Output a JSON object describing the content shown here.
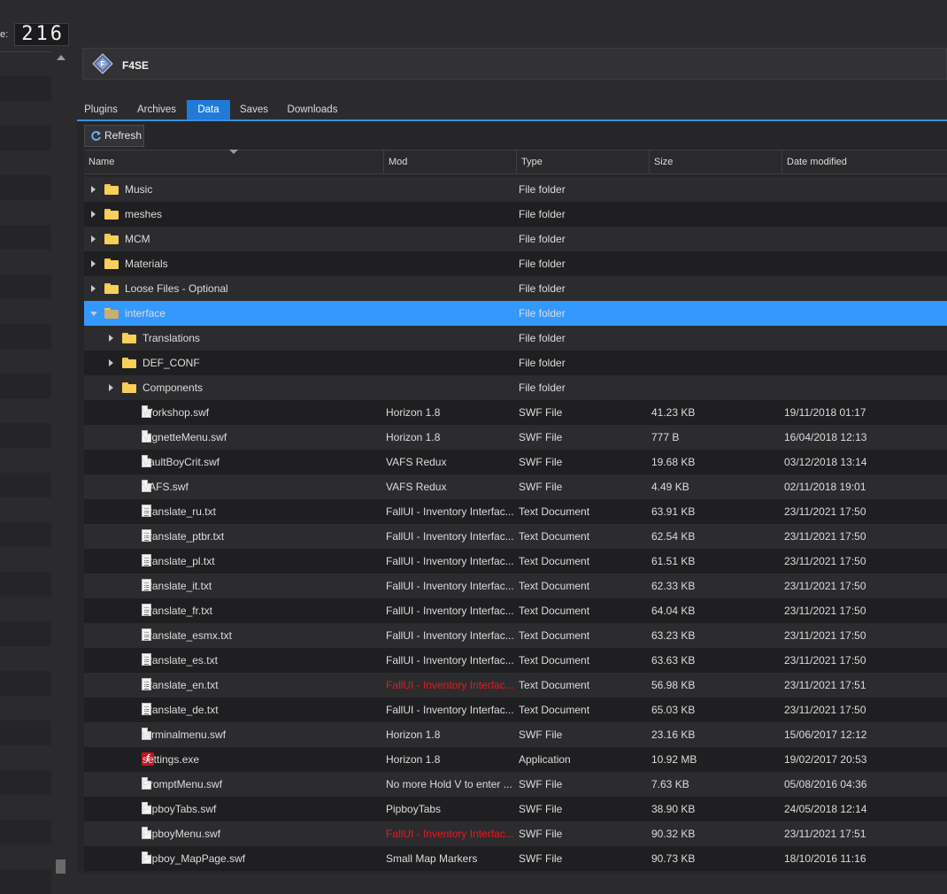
{
  "counter": {
    "label": "e:",
    "value": "216"
  },
  "profile": {
    "name": "F4SE"
  },
  "tabs": [
    {
      "label": "Plugins",
      "active": false
    },
    {
      "label": "Archives",
      "active": false
    },
    {
      "label": "Data",
      "active": true
    },
    {
      "label": "Saves",
      "active": false
    },
    {
      "label": "Downloads",
      "active": false
    }
  ],
  "toolbar": {
    "refresh_label": "Refresh"
  },
  "columns": {
    "name": "Name",
    "mod": "Mod",
    "type": "Type",
    "size": "Size",
    "date": "Date modified"
  },
  "rows": [
    {
      "name": "Music",
      "mod": "",
      "type": "File folder",
      "size": "",
      "date": "",
      "kind": "folder",
      "depth": 0,
      "expander": "closed"
    },
    {
      "name": "meshes",
      "mod": "",
      "type": "File folder",
      "size": "",
      "date": "",
      "kind": "folder",
      "depth": 0,
      "expander": "closed"
    },
    {
      "name": "MCM",
      "mod": "",
      "type": "File folder",
      "size": "",
      "date": "",
      "kind": "folder",
      "depth": 0,
      "expander": "closed"
    },
    {
      "name": "Materials",
      "mod": "",
      "type": "File folder",
      "size": "",
      "date": "",
      "kind": "folder",
      "depth": 0,
      "expander": "closed"
    },
    {
      "name": "Loose Files - Optional",
      "mod": "",
      "type": "File folder",
      "size": "",
      "date": "",
      "kind": "folder",
      "depth": 0,
      "expander": "closed"
    },
    {
      "name": "interface",
      "mod": "",
      "type": "File folder",
      "size": "",
      "date": "",
      "kind": "folder-open",
      "depth": 0,
      "expander": "open",
      "selected": true
    },
    {
      "name": "Translations",
      "mod": "",
      "type": "File folder",
      "size": "",
      "date": "",
      "kind": "folder",
      "depth": 1,
      "expander": "closed"
    },
    {
      "name": "DEF_CONF",
      "mod": "",
      "type": "File folder",
      "size": "",
      "date": "",
      "kind": "folder",
      "depth": 1,
      "expander": "closed"
    },
    {
      "name": "Components",
      "mod": "",
      "type": "File folder",
      "size": "",
      "date": "",
      "kind": "folder",
      "depth": 1,
      "expander": "closed"
    },
    {
      "name": "Workshop.swf",
      "mod": "Horizon 1.8",
      "type": "SWF File",
      "size": "41.23 KB",
      "date": "19/11/2018 01:17",
      "kind": "file",
      "depth": 1
    },
    {
      "name": "VignetteMenu.swf",
      "mod": "Horizon 1.8",
      "type": "SWF File",
      "size": "777 B",
      "date": "16/04/2018 12:13",
      "kind": "file",
      "depth": 1
    },
    {
      "name": "VaultBoyCrit.swf",
      "mod": "VAFS Redux",
      "type": "SWF File",
      "size": "19.68 KB",
      "date": "03/12/2018 13:14",
      "kind": "file",
      "depth": 1
    },
    {
      "name": "VAFS.swf",
      "mod": "VAFS Redux",
      "type": "SWF File",
      "size": "4.49 KB",
      "date": "02/11/2018 19:01",
      "kind": "file",
      "depth": 1
    },
    {
      "name": "Translate_ru.txt",
      "mod": "FallUI - Inventory Interfac...",
      "type": "Text Document",
      "size": "63.91 KB",
      "date": "23/11/2021 17:50",
      "kind": "txt",
      "depth": 1
    },
    {
      "name": "Translate_ptbr.txt",
      "mod": "FallUI - Inventory Interfac...",
      "type": "Text Document",
      "size": "62.54 KB",
      "date": "23/11/2021 17:50",
      "kind": "txt",
      "depth": 1
    },
    {
      "name": "Translate_pl.txt",
      "mod": "FallUI - Inventory Interfac...",
      "type": "Text Document",
      "size": "61.51 KB",
      "date": "23/11/2021 17:50",
      "kind": "txt",
      "depth": 1
    },
    {
      "name": "Translate_it.txt",
      "mod": "FallUI - Inventory Interfac...",
      "type": "Text Document",
      "size": "62.33 KB",
      "date": "23/11/2021 17:50",
      "kind": "txt",
      "depth": 1
    },
    {
      "name": "Translate_fr.txt",
      "mod": "FallUI - Inventory Interfac...",
      "type": "Text Document",
      "size": "64.04 KB",
      "date": "23/11/2021 17:50",
      "kind": "txt",
      "depth": 1
    },
    {
      "name": "Translate_esmx.txt",
      "mod": "FallUI - Inventory Interfac...",
      "type": "Text Document",
      "size": "63.23 KB",
      "date": "23/11/2021 17:50",
      "kind": "txt",
      "depth": 1
    },
    {
      "name": "Translate_es.txt",
      "mod": "FallUI - Inventory Interfac...",
      "type": "Text Document",
      "size": "63.63 KB",
      "date": "23/11/2021 17:50",
      "kind": "txt",
      "depth": 1
    },
    {
      "name": "Translate_en.txt",
      "mod": "FallUI - Inventory Interfac...",
      "type": "Text Document",
      "size": "56.98 KB",
      "date": "23/11/2021 17:51",
      "kind": "txt",
      "depth": 1,
      "mod_conflict": true
    },
    {
      "name": "Translate_de.txt",
      "mod": "FallUI - Inventory Interfac...",
      "type": "Text Document",
      "size": "65.03 KB",
      "date": "23/11/2021 17:50",
      "kind": "txt",
      "depth": 1
    },
    {
      "name": "terminalmenu.swf",
      "mod": "Horizon 1.8",
      "type": "SWF File",
      "size": "23.16 KB",
      "date": "15/06/2017 12:12",
      "kind": "file",
      "depth": 1
    },
    {
      "name": "settings.exe",
      "mod": "Horizon 1.8",
      "type": "Application",
      "size": "10.92 MB",
      "date": "19/02/2017 20:53",
      "kind": "exe",
      "depth": 1
    },
    {
      "name": "PromptMenu.swf",
      "mod": "No more Hold V to enter ...",
      "type": "SWF File",
      "size": "7.63 KB",
      "date": "05/08/2016 04:36",
      "kind": "file",
      "depth": 1
    },
    {
      "name": "PipboyTabs.swf",
      "mod": "PipboyTabs",
      "type": "SWF File",
      "size": "38.90 KB",
      "date": "24/05/2018 12:14",
      "kind": "file",
      "depth": 1
    },
    {
      "name": "PipboyMenu.swf",
      "mod": "FallUI - Inventory Interfac...",
      "type": "SWF File",
      "size": "90.32 KB",
      "date": "23/11/2021 17:51",
      "kind": "file",
      "depth": 1,
      "mod_conflict": true
    },
    {
      "name": "Pipboy_MapPage.swf",
      "mod": "Small Map Markers",
      "type": "SWF File",
      "size": "90.73 KB",
      "date": "18/10/2016 11:16",
      "kind": "file",
      "depth": 1
    }
  ],
  "colors": {
    "accent": "#1f7ad8",
    "selection": "#3399ff",
    "conflict": "#e8191c",
    "folder": "#f8cf5a"
  }
}
